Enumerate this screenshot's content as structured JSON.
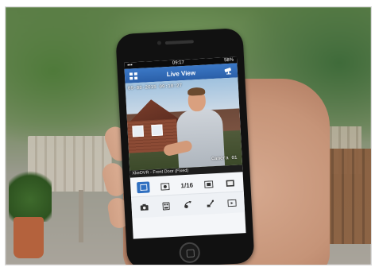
{
  "status_bar": {
    "time": "09:17",
    "battery": "58%"
  },
  "nav": {
    "title": "Live View"
  },
  "video": {
    "timestamp": "05-08-2015 09:10:27",
    "camera_overlay": "Camera 01",
    "channel_label": "XkeDVR - Front Door (Fixed)"
  },
  "toolbar": {
    "page_indicator": "1/16"
  },
  "icons": {
    "menu": "grid-icon",
    "cctv": "cctv-camera-icon",
    "layout_single": "single-view-icon",
    "prev": "previous-channel-icon",
    "next": "next-channel-icon",
    "multi": "multi-view-icon",
    "snapshot": "camera-icon",
    "record": "record-icon",
    "ptz": "ptz-icon",
    "settings": "settings-icon",
    "fullscreen": "fullscreen-icon"
  },
  "colors": {
    "accent": "#2f6fc0",
    "navbar": "#2a5fa8"
  }
}
